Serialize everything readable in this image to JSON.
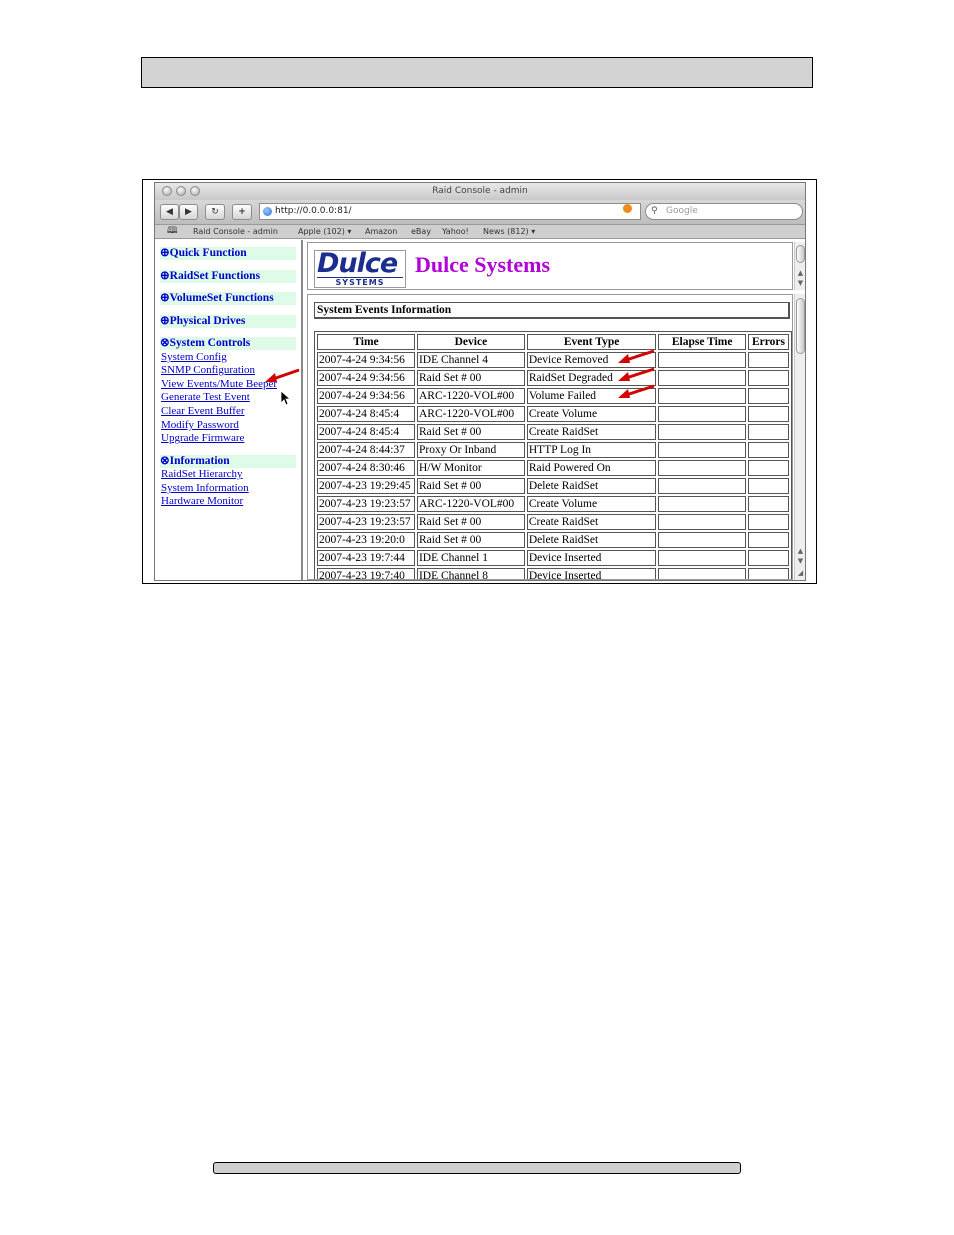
{
  "browser": {
    "title": "Raid Console - admin",
    "url": "http://0.0.0.0:81/",
    "search_placeholder": "Google",
    "bookmarks": [
      "Raid Console - admin",
      "Apple (102) ▾",
      "Amazon",
      "eBay",
      "Yahoo!",
      "News (812) ▾"
    ]
  },
  "sidebar": {
    "sections": [
      {
        "label": "⊕Quick Function"
      },
      {
        "label": "⊕RaidSet Functions"
      },
      {
        "label": "⊕VolumeSet Functions"
      },
      {
        "label": "⊕Physical Drives"
      },
      {
        "label": "⊗System Controls",
        "links": [
          "System Config",
          "SNMP Configuration",
          "View Events/Mute Beeper",
          "Generate Test Event",
          "Clear Event Buffer",
          "Modify Password",
          "Upgrade Firmware"
        ]
      },
      {
        "label": "⊗Information",
        "links": [
          "RaidSet Hierarchy",
          "System Information",
          "Hardware Monitor"
        ]
      }
    ]
  },
  "main": {
    "logo_text": "Dulce",
    "logo_sub": "SYSTEMS",
    "brand_title": "Dulce Systems",
    "events_title": "System Events Information",
    "columns": [
      "Time",
      "Device",
      "Event Type",
      "Elapse Time",
      "Errors"
    ],
    "rows": [
      [
        "2007-4-24 9:34:56",
        "IDE Channel 4",
        "Device Removed",
        "",
        ""
      ],
      [
        "2007-4-24 9:34:56",
        "Raid Set # 00",
        "RaidSet Degraded",
        "",
        ""
      ],
      [
        "2007-4-24 9:34:56",
        "ARC-1220-VOL#00",
        "Volume Failed",
        "",
        ""
      ],
      [
        "2007-4-24 8:45:4",
        "ARC-1220-VOL#00",
        "Create Volume",
        "",
        ""
      ],
      [
        "2007-4-24 8:45:4",
        "Raid Set # 00",
        "Create RaidSet",
        "",
        ""
      ],
      [
        "2007-4-24 8:44:37",
        "Proxy Or Inband",
        "HTTP Log In",
        "",
        ""
      ],
      [
        "2007-4-24 8:30:46",
        "H/W Monitor",
        "Raid Powered On",
        "",
        ""
      ],
      [
        "2007-4-23 19:29:45",
        "Raid Set # 00",
        "Delete RaidSet",
        "",
        ""
      ],
      [
        "2007-4-23 19:23:57",
        "ARC-1220-VOL#00",
        "Create Volume",
        "",
        ""
      ],
      [
        "2007-4-23 19:23:57",
        "Raid Set # 00",
        "Create RaidSet",
        "",
        ""
      ],
      [
        "2007-4-23 19:20:0",
        "Raid Set # 00",
        "Delete RaidSet",
        "",
        ""
      ],
      [
        "2007-4-23 19:7:44",
        "IDE Channel 1",
        "Device Inserted",
        "",
        ""
      ],
      [
        "2007-4-23 19:7:40",
        "IDE Channel 8",
        "Device Inserted",
        "",
        ""
      ]
    ]
  },
  "colors": {
    "link": "#0000cc",
    "section_bg": "#ddfbe6",
    "brand": "#b200d8",
    "logo": "#1b2d8f",
    "annotation_arrow": "#d40000"
  }
}
